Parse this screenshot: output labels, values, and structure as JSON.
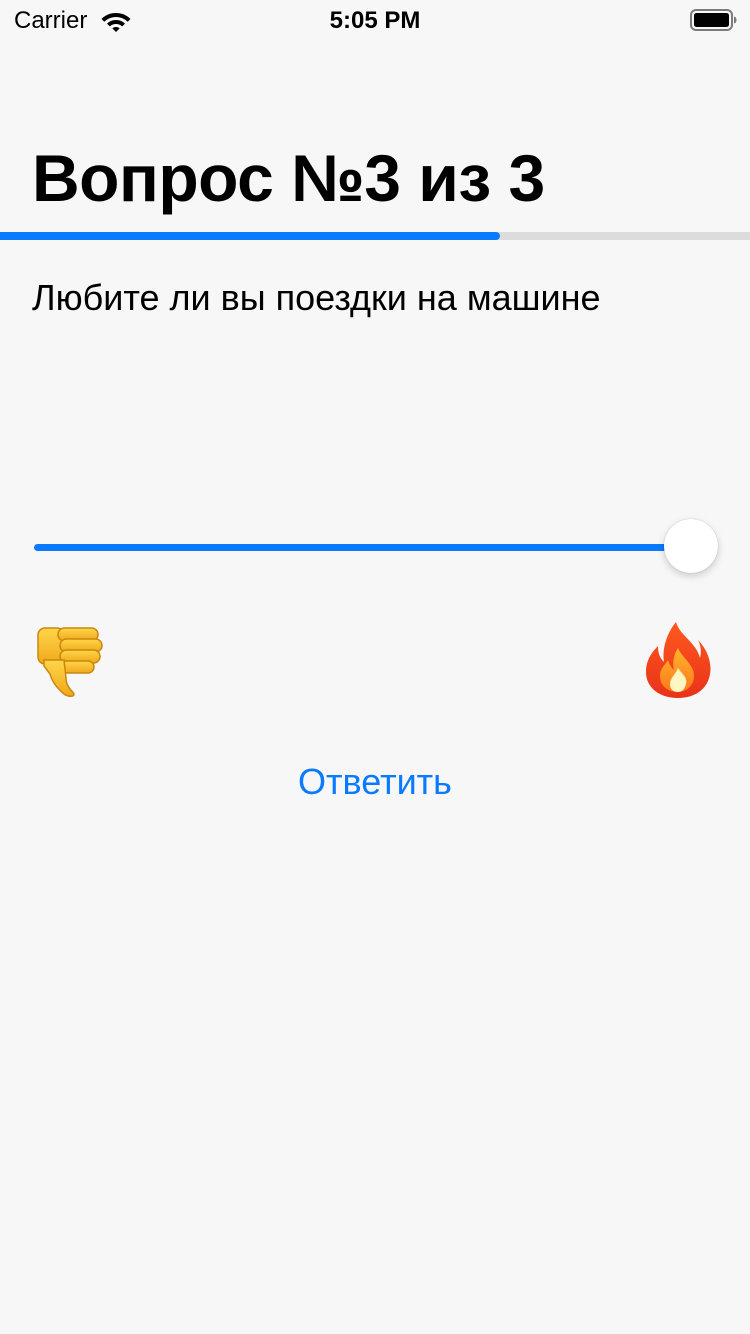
{
  "status_bar": {
    "carrier": "Carrier",
    "time": "5:05 PM",
    "wifi_icon": "wifi-icon",
    "battery_icon": "battery-icon"
  },
  "question": {
    "title": "Вопрос №3 из 3",
    "current": 3,
    "total": 3,
    "text": "Любите ли вы поездки на машине"
  },
  "progress": {
    "fraction": 0.667
  },
  "slider": {
    "value": 1.0,
    "min_icon": "thumbs-down-icon",
    "max_icon": "fire-icon"
  },
  "answer_button": {
    "label": "Ответить"
  },
  "colors": {
    "accent": "#0a7aff",
    "background": "#f8f7f8",
    "track": "#dddcdd"
  }
}
